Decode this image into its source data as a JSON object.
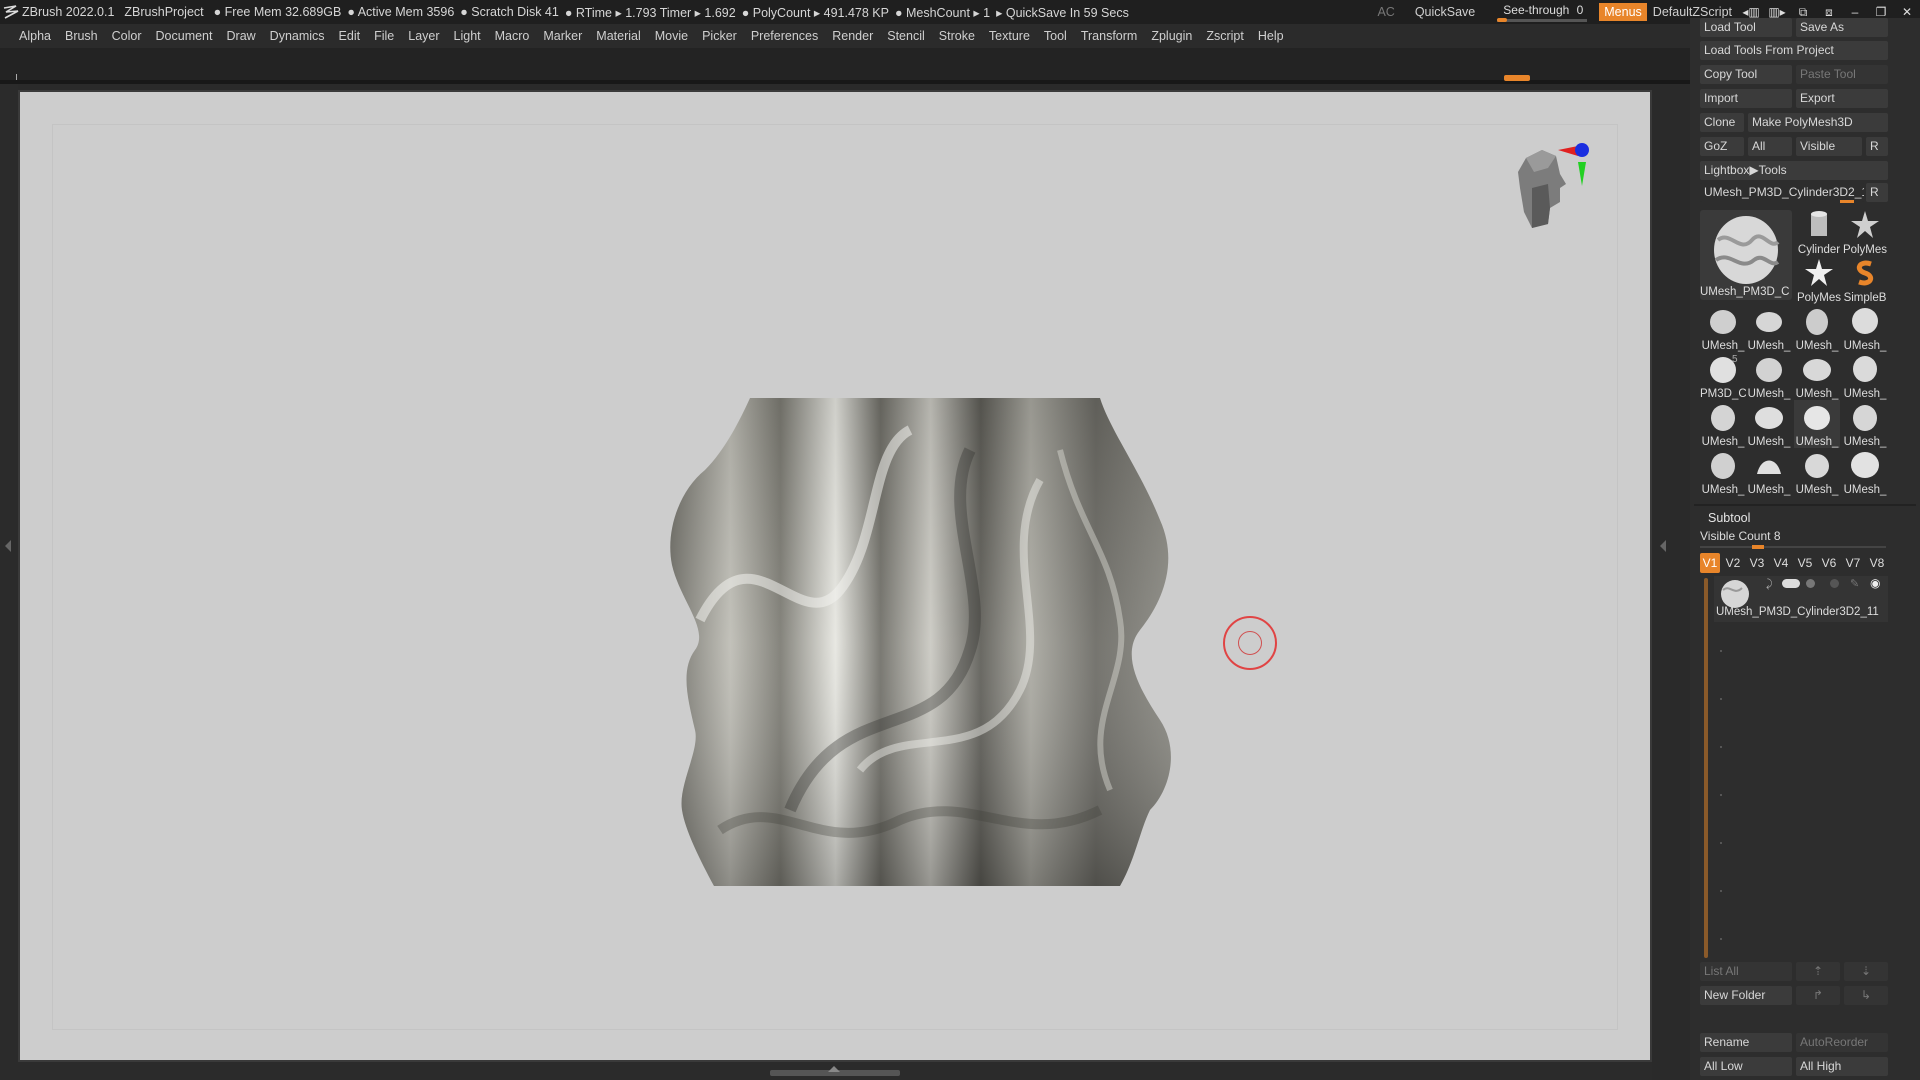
{
  "titlebar": {
    "app": "ZBrush 2022.0.1",
    "project": "ZBrushProject",
    "free_mem": "● Free Mem 32.689GB",
    "active_mem": "● Active Mem 3596",
    "scratch_disk": "● Scratch Disk 41",
    "rtime": "● RTime ▸ 1.793 Timer ▸ 1.692",
    "polycount": "● PolyCount ▸ 491.478 KP",
    "meshcount": "● MeshCount ▸ 1",
    "quicksave_info": "▸ QuickSave In 59 Secs",
    "ac": "AC",
    "quicksave": "QuickSave",
    "see_through_label": "See-through",
    "see_through_value": "0",
    "menus": "Menus",
    "default_script": "DefaultZScript"
  },
  "menubar": [
    "Alpha",
    "Brush",
    "Color",
    "Document",
    "Draw",
    "Dynamics",
    "Edit",
    "File",
    "Layer",
    "Light",
    "Macro",
    "Marker",
    "Material",
    "Movie",
    "Picker",
    "Preferences",
    "Render",
    "Stencil",
    "Stroke",
    "Texture",
    "Tool",
    "Transform",
    "Zplugin",
    "Zscript",
    "Help"
  ],
  "tool_panel": {
    "load_tool": "Load Tool",
    "save_as": "Save As",
    "load_tools_from_project": "Load Tools From Project",
    "copy_tool": "Copy Tool",
    "paste_tool": "Paste Tool",
    "import": "Import",
    "export": "Export",
    "clone": "Clone",
    "make_polymesh3d": "Make PolyMesh3D",
    "goz": "GoZ",
    "all": "All",
    "visible": "Visible",
    "r": "R",
    "lightbox_tools": "Lightbox▶Tools",
    "current_tool": "UMesh_PM3D_Cylinder3D2_1",
    "current_tool_r": "R",
    "current_tool_caption": "UMesh_PM3D_C",
    "thumbs_row0": [
      {
        "cap": "Cylinder"
      },
      {
        "cap": "PolyMes"
      }
    ],
    "thumbs_row1": [
      {
        "cap": "PolyMes"
      },
      {
        "cap": "SimpleB"
      }
    ],
    "grid": [
      [
        "UMesh_",
        "UMesh_",
        "UMesh_",
        "UMesh_"
      ],
      [
        "PM3D_C",
        "UMesh_",
        "UMesh_",
        "UMesh_"
      ],
      [
        "UMesh_",
        "UMesh_",
        "UMesh_",
        "UMesh_"
      ],
      [
        "UMesh_",
        "UMesh_",
        "UMesh_",
        "UMesh_"
      ]
    ],
    "grid_badge": "5"
  },
  "subtool": {
    "title": "Subtool",
    "visible_count": "Visible Count 8",
    "tabs": [
      "V1",
      "V2",
      "V3",
      "V4",
      "V5",
      "V6",
      "V7",
      "V8"
    ],
    "active_tab": "V1",
    "item_name": "UMesh_PM3D_Cylinder3D2_11",
    "list_all": "List All",
    "new_folder": "New Folder",
    "rename": "Rename",
    "auto_reorder": "AutoReorder",
    "all_low": "All Low",
    "all_high": "All High"
  },
  "colors": {
    "accent": "#e8852a",
    "canvas_bg": "#cdcdcd",
    "panel_bg": "#2d2d2d",
    "cursor_ring": "#e04444"
  }
}
